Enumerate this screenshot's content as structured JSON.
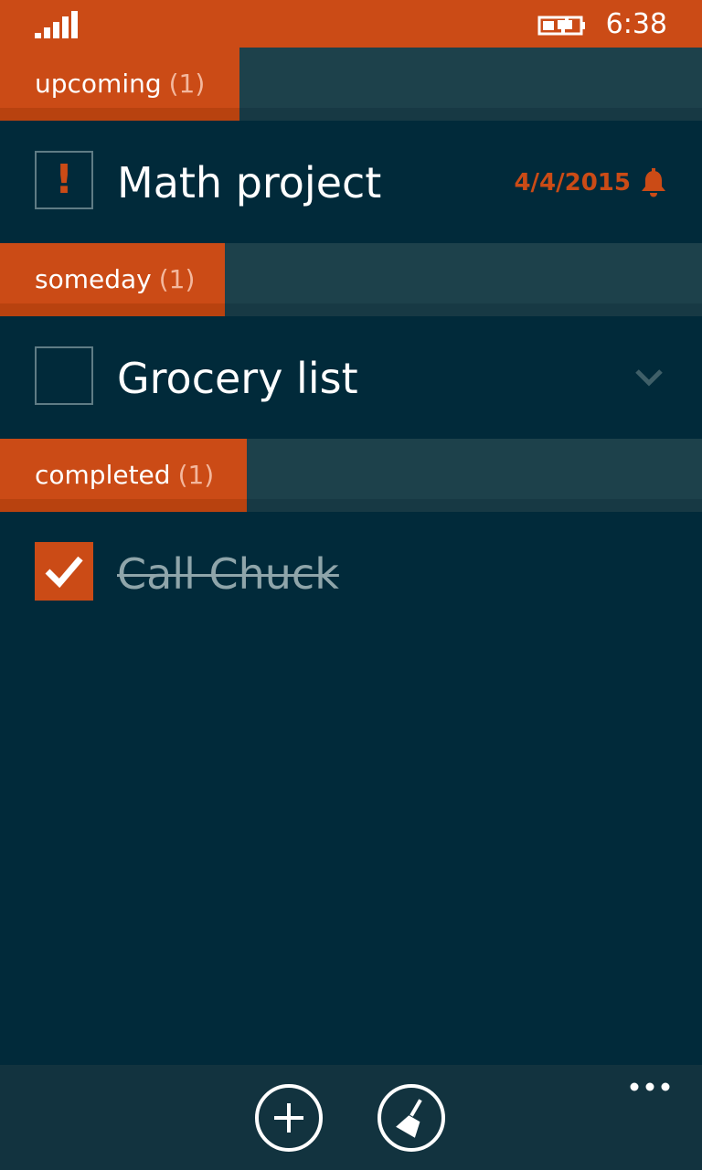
{
  "status_bar": {
    "time": "6:38",
    "signal_icon": "signal-strength-icon",
    "battery_icon": "battery-charging-icon"
  },
  "sections": [
    {
      "label": "upcoming",
      "count": "(1)"
    },
    {
      "label": "someday",
      "count": "(1)"
    },
    {
      "label": "completed",
      "count": "(1)"
    }
  ],
  "tasks": [
    {
      "title": "Math project",
      "due": "4/4/2015",
      "important": true,
      "completed": false,
      "icon": "alarm-bell-icon"
    },
    {
      "title": "Grocery list",
      "important": false,
      "completed": false,
      "icon": "chevron-down-icon"
    },
    {
      "title": "Call Chuck",
      "important": false,
      "completed": true,
      "icon": "checkmark-icon"
    }
  ],
  "app_bar": {
    "add_icon": "add-icon",
    "clear_icon": "broom-icon",
    "more_icon": "more-icon"
  },
  "colors": {
    "accent": "#cb4b16",
    "background": "#012a3a",
    "header_band": "#1d414b",
    "app_bar": "#12333f"
  }
}
